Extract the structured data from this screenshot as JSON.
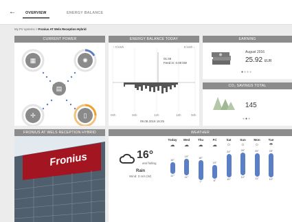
{
  "nav": {
    "back_icon": "←",
    "tab_overview": "OVERVIEW",
    "tab_energy": "ENERGY BALANCE"
  },
  "breadcrumb": {
    "root": "My PV systems",
    "sep": ">",
    "current": "Fronius AT Wels Reception Hybrid"
  },
  "current_power": {
    "title": "CURRENT POWER",
    "nodes": {
      "grid": {
        "icon": "grid-pylon-icon",
        "value": ""
      },
      "load": {
        "icon": "lightbulb-icon",
        "value": ""
      },
      "pv": {
        "icon": "solar-panel-icon",
        "value": ""
      },
      "inverter": {
        "icon": "inverter-icon"
      },
      "battery": {
        "icon": "battery-icon",
        "value": ""
      }
    }
  },
  "energy_balance": {
    "title": "ENERGY BALANCE TODAY",
    "left_top": "↑ 0 kWh",
    "right_top": "8 kWh ↓",
    "tooltip_time": "01:45",
    "tooltip_feed": "Feed in: 0.00 kW",
    "x_ticks": [
      "00h",
      "06h",
      "12h",
      "18h",
      "00h"
    ],
    "date": "09.08.2016 16:25"
  },
  "earning": {
    "title": "EARNING",
    "date": "August 2016",
    "value": "25.92",
    "currency": "EUR"
  },
  "co2": {
    "title": "CO₂ SAVINGS TOTAL",
    "value": "145"
  },
  "photo": {
    "title": "FRONIUS AT WELS RECEPTION HYBRID",
    "sign": "Fronius"
  },
  "weather": {
    "title": "WEATHER",
    "temp": "16°",
    "trend": "and falling",
    "condition": "Rain",
    "wind": "Wind: 3 m/s (W)",
    "days": [
      {
        "name": "Today",
        "icon": "☁",
        "hi": "16°",
        "lo": "12°",
        "top": 14,
        "bottom": 23
      },
      {
        "name": "Wed",
        "icon": "☁",
        "hi": "19°",
        "lo": "11°",
        "top": 9,
        "bottom": 25
      },
      {
        "name": "Thu",
        "icon": "☁",
        "hi": "18°",
        "lo": "7°",
        "top": 11,
        "bottom": 32
      },
      {
        "name": "Fri",
        "icon": "☁",
        "hi": "15°",
        "lo": "8°",
        "top": 18,
        "bottom": 30
      },
      {
        "name": "Sat",
        "icon": "☼",
        "hi": "24°",
        "lo": "10°",
        "top": 2,
        "bottom": 28
      },
      {
        "name": "Sun",
        "icon": "☼",
        "hi": "26°",
        "lo": "12°",
        "top": 0,
        "bottom": 25
      },
      {
        "name": "Mon",
        "icon": "☼",
        "hi": "25°",
        "lo": "11°",
        "top": 1,
        "bottom": 27
      },
      {
        "name": "Tue",
        "icon": "☂",
        "hi": "25°",
        "lo": "10°",
        "top": 1,
        "bottom": 28
      }
    ]
  }
}
